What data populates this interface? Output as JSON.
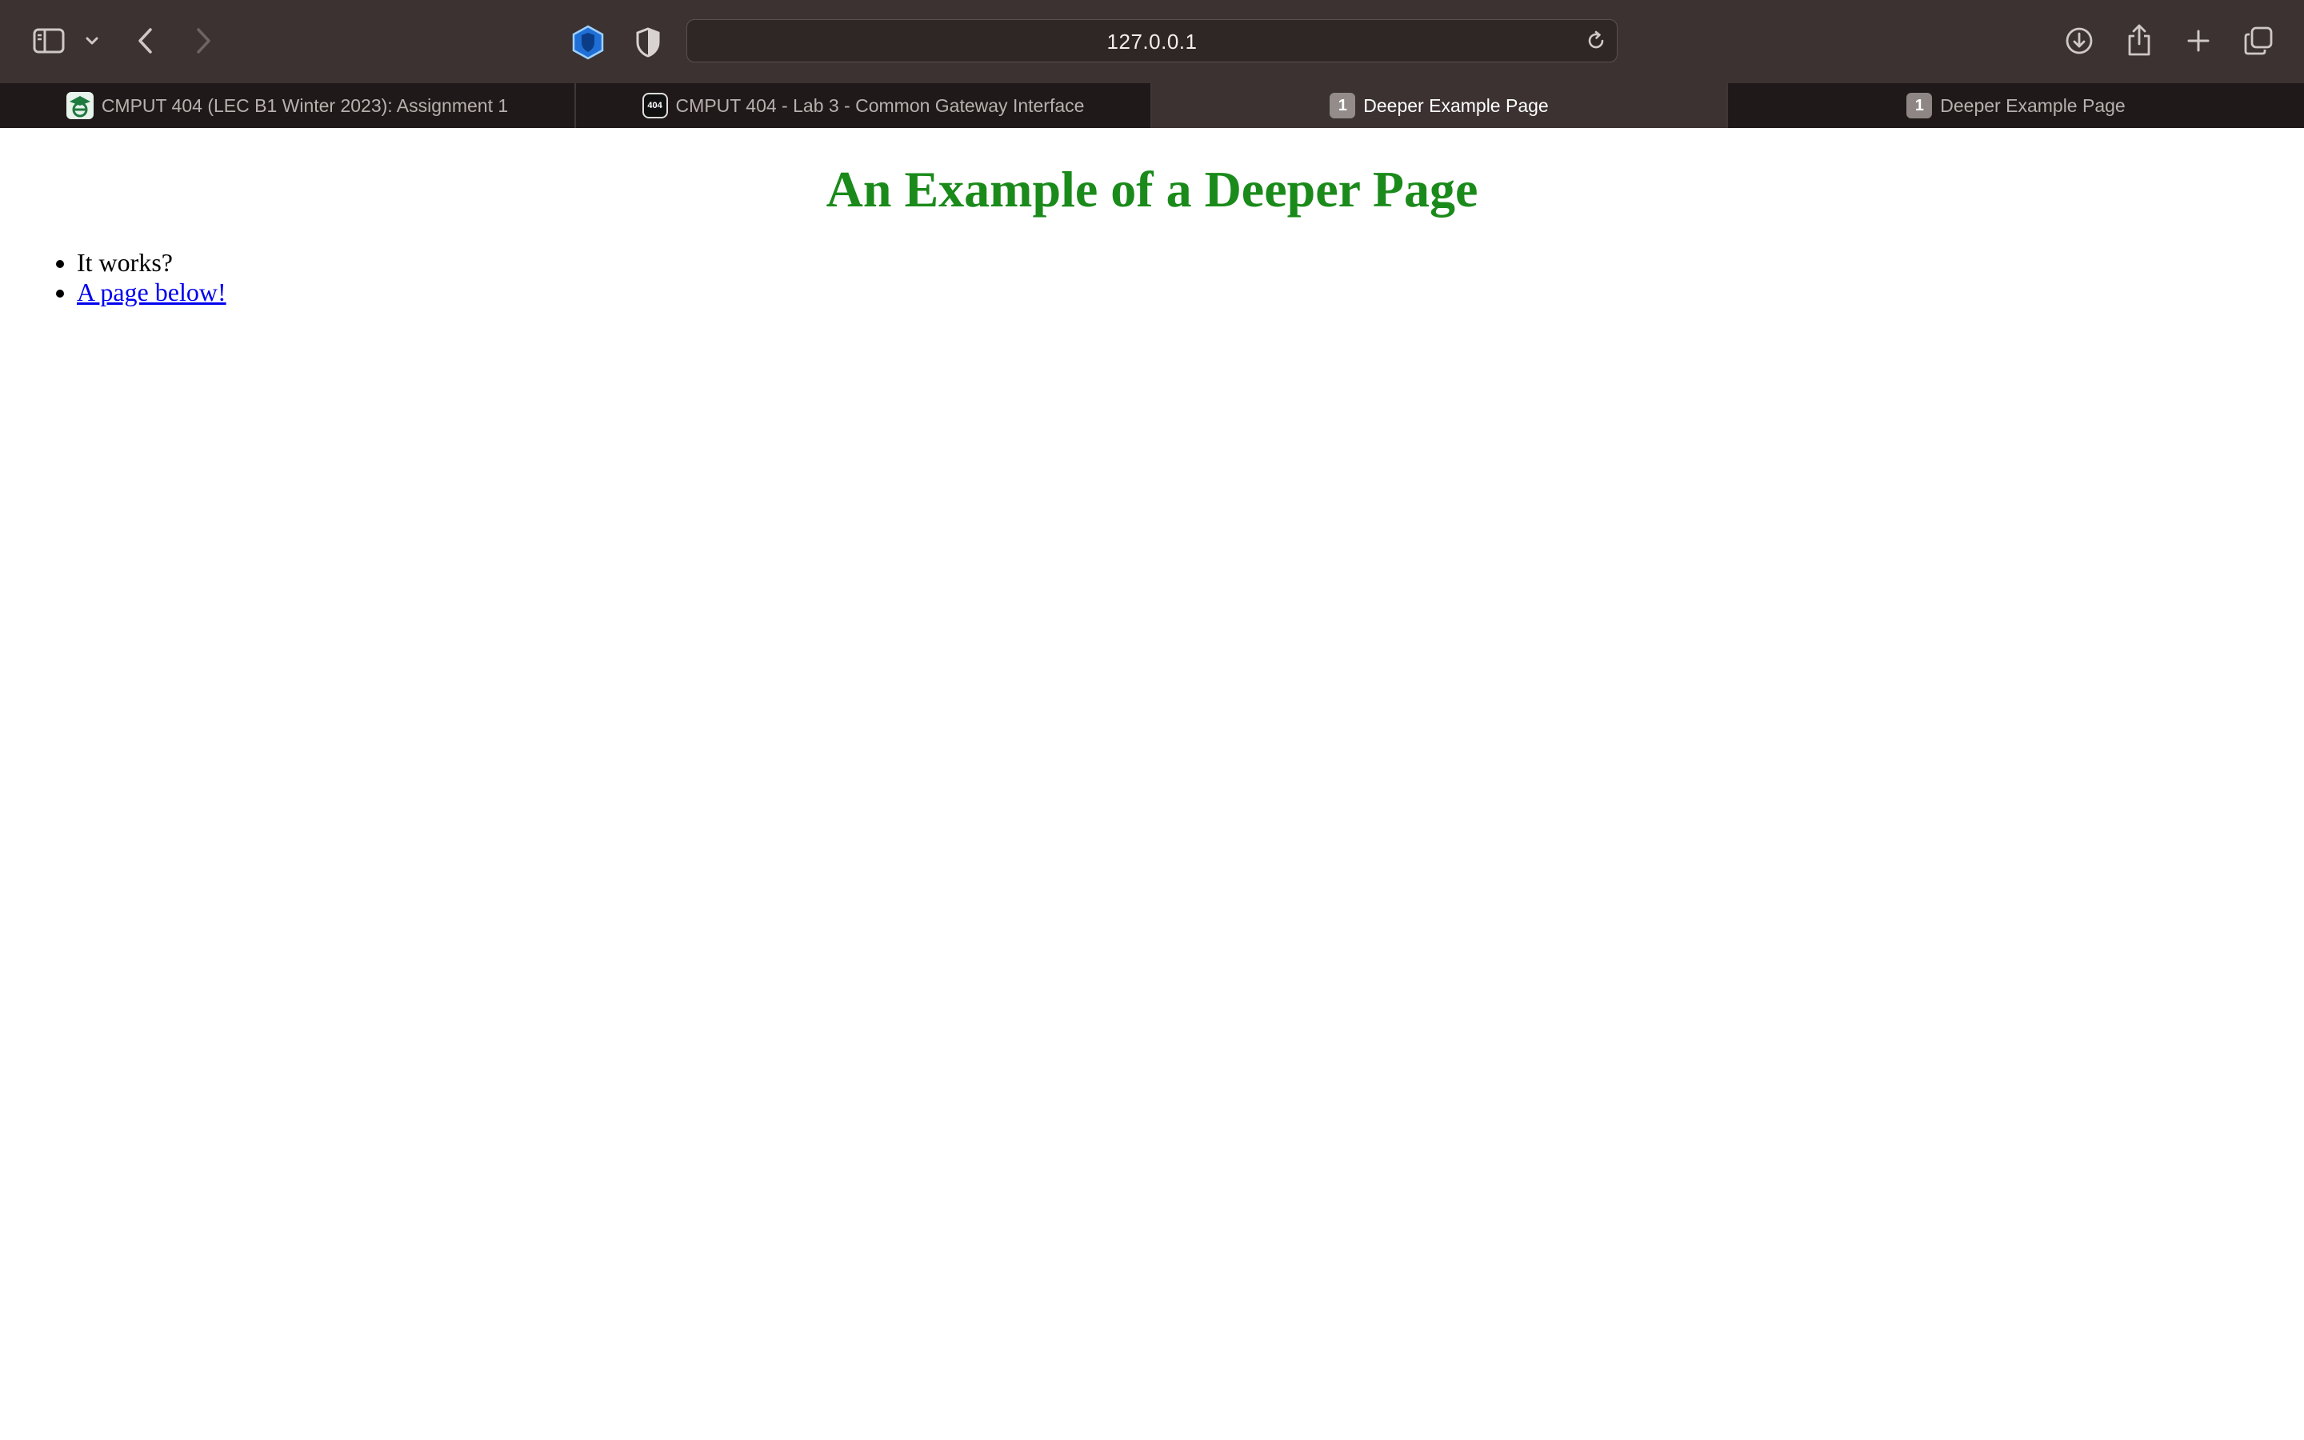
{
  "browser": {
    "address": "127.0.0.1",
    "toolbar_icons": {
      "sidebar": "sidebar-icon",
      "sidebar_menu": "chevron-down-icon",
      "back": "chevron-left-icon",
      "forward": "chevron-right-icon",
      "extension_1": "hexagon-shield-icon",
      "extension_2": "half-shield-icon",
      "reload": "reload-icon",
      "downloads": "download-icon",
      "share": "share-icon",
      "new_tab": "plus-icon",
      "tab_overview": "tabs-overview-icon"
    },
    "tabs": [
      {
        "label": "CMPUT 404 (LEC B1 Winter 2023): Assignment 1",
        "favicon": "eclass-favicon"
      },
      {
        "label": "CMPUT 404 - Lab 3 - Common Gateway Interface",
        "favicon": "404-favicon",
        "favicon_text": "404"
      },
      {
        "label": "Deeper Example Page",
        "favicon": "number-favicon",
        "favicon_text": "1",
        "active": true
      },
      {
        "label": "Deeper Example Page",
        "favicon": "number-favicon",
        "favicon_text": "1"
      }
    ]
  },
  "page": {
    "heading": "An Example of a Deeper Page",
    "heading_color": "#1a8a1a",
    "items": [
      {
        "text": "It works?"
      },
      {
        "text": "A page below!",
        "link": true
      }
    ]
  }
}
